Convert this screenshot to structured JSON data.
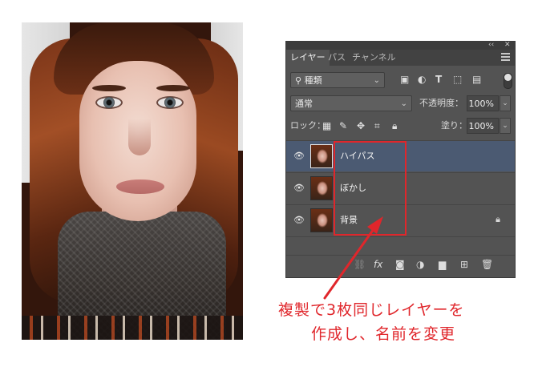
{
  "panel": {
    "window_controls": {
      "collapse": "‹‹",
      "close": "✕"
    },
    "tabs": [
      {
        "label": "レイヤー",
        "active": true
      },
      {
        "label": "パス",
        "active": false
      },
      {
        "label": "チャンネル",
        "active": false
      }
    ],
    "filter": {
      "kind_label": "種類",
      "search_icon": "search-icon"
    },
    "blend": {
      "mode": "通常",
      "opacity_label": "不透明度：",
      "opacity_value": "100%"
    },
    "lock": {
      "label": "ロック：",
      "fill_label": "塗り：",
      "fill_value": "100%"
    },
    "layers": [
      {
        "name": "ハイパス",
        "selected": true,
        "locked": false
      },
      {
        "name": "ぼかし",
        "selected": false,
        "locked": false
      },
      {
        "name": "背景",
        "selected": false,
        "locked": true
      }
    ],
    "footer_icons": [
      "link-icon",
      "fx-icon",
      "mask-icon",
      "adjustment-icon",
      "folder-icon",
      "new-layer-icon",
      "trash-icon"
    ],
    "selected_color": "#4b5a72",
    "panel_color": "#535353"
  },
  "annotation": {
    "line1": "複製で3枚同じレイヤーを",
    "line2": "作成し、名前を変更",
    "color": "#e0262b"
  }
}
